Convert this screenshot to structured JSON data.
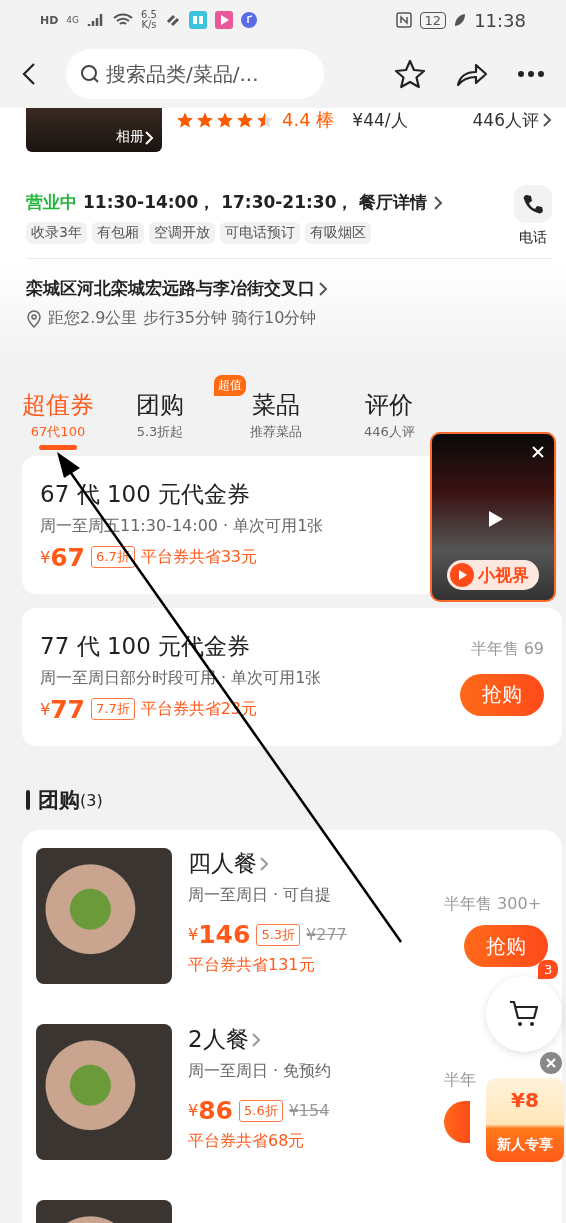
{
  "status_bar": {
    "hd": "HD",
    "network": "4G",
    "speed": "6.5",
    "speed_unit": "K/s",
    "battery": "12",
    "time": "11:38"
  },
  "nav": {
    "search_placeholder": "搜索品类/菜品/..."
  },
  "shop": {
    "album": "相册",
    "stars": 4.5,
    "rating": "4.4 棒",
    "price": "¥44/人",
    "reviews": "446人评"
  },
  "hours": {
    "status": "营业中",
    "times": "11:30-14:00， 17:30-21:30，",
    "details": "餐厅详情",
    "phone": "电话"
  },
  "tags": [
    "收录3年",
    "有包厢",
    "空调开放",
    "可电话预订",
    "有吸烟区"
  ],
  "address": {
    "line": "栾城区河北栾城宏远路与李冶街交叉口",
    "distance": "距您2.9公里 步行35分钟 骑行10分钟"
  },
  "tabs": [
    {
      "label": "超值券",
      "sub": "67代100",
      "selected": true
    },
    {
      "label": "团购",
      "sub": "5.3折起",
      "selected": false,
      "badge": "超值"
    },
    {
      "label": "菜品",
      "sub": "推荐菜品",
      "selected": false
    },
    {
      "label": "评价",
      "sub": "446人评",
      "selected": false
    }
  ],
  "coupons": [
    {
      "title": "67 代 100 元代金券",
      "terms": "周一至周五11:30-14:00 · 单次可用1张",
      "currency": "¥",
      "price": "67",
      "discount": "6.7折",
      "saving": "平台券共省33元",
      "behind_video": true
    },
    {
      "title": "77 代 100 元代金券",
      "terms": "周一至周日部分时段可用 · 单次可用1张",
      "currency": "¥",
      "price": "77",
      "discount": "7.7折",
      "saving": "平台券共省23元",
      "sold": "半年售 69",
      "button": "抢购"
    }
  ],
  "group": {
    "title": "团购",
    "count": "(3)",
    "deals": [
      {
        "kind": "offer",
        "title": "四人餐",
        "terms": "周一至周日 · 可自提",
        "currency": "¥",
        "price": "146",
        "discount": "5.3折",
        "original": "¥277",
        "saving": "平台券共省131元",
        "sold": "半年售 300+",
        "button": "抢购"
      },
      {
        "kind": "offer",
        "title": "2人餐",
        "terms": "周一至周日 · 免预约",
        "currency": "¥",
        "price": "86",
        "discount": "5.6折",
        "original": "¥154",
        "saving": "平台券共省68元",
        "sold": "半年",
        "button_cut": true
      },
      {
        "kind": "peek"
      }
    ]
  },
  "video": {
    "label": "小视界"
  },
  "cart": {
    "badge": "3"
  },
  "promo": {
    "amount": "¥8",
    "label": "新人专享"
  }
}
